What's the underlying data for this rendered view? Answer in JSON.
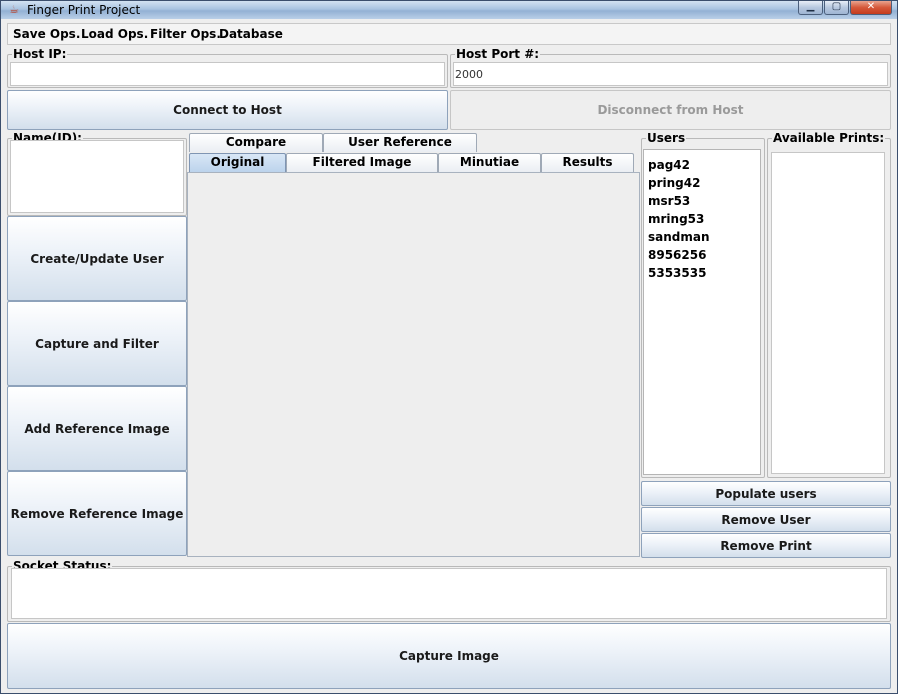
{
  "window": {
    "title": "Finger Print Project",
    "controls": {
      "minimize": "▁",
      "maximize": "▢",
      "close": "✕"
    }
  },
  "menu": {
    "items": [
      "Save Ops.",
      "Load Ops.",
      "Filter Ops.",
      "Database"
    ]
  },
  "host": {
    "ip_label": "Host IP:",
    "ip_value": "",
    "port_label": "Host Port #:",
    "port_value": "2000"
  },
  "connection": {
    "connect_label": "Connect to Host",
    "disconnect_label": "Disconnect from Host"
  },
  "name_panel": {
    "label": "Name(ID):"
  },
  "actions": {
    "create_update": "Create/Update User",
    "capture_filter": "Capture and Filter",
    "add_reference": "Add Reference Image",
    "remove_reference": "Remove Reference Image"
  },
  "tabs": {
    "top": [
      "Compare Constants",
      "User Reference Images"
    ],
    "bottom": [
      "Original",
      "Filtered Image",
      "Minutiae",
      "Results"
    ],
    "selected": "Original"
  },
  "users": {
    "label": "Users",
    "items": [
      "pag42",
      "pring42",
      "msr53",
      "mring53",
      "sandman",
      "8956256",
      "5353535"
    ]
  },
  "prints": {
    "label": "Available Prints:"
  },
  "user_actions": {
    "populate": "Populate users",
    "remove_user": "Remove User",
    "remove_print": "Remove Print"
  },
  "socket": {
    "label": "Socket Status:"
  },
  "capture": {
    "label": "Capture Image"
  },
  "colors": {
    "titlebar": "#a9c3e0",
    "button_border": "#8ea2bb",
    "window_bg": "#eeeeee",
    "selected_tab": "#bcd3ec"
  }
}
